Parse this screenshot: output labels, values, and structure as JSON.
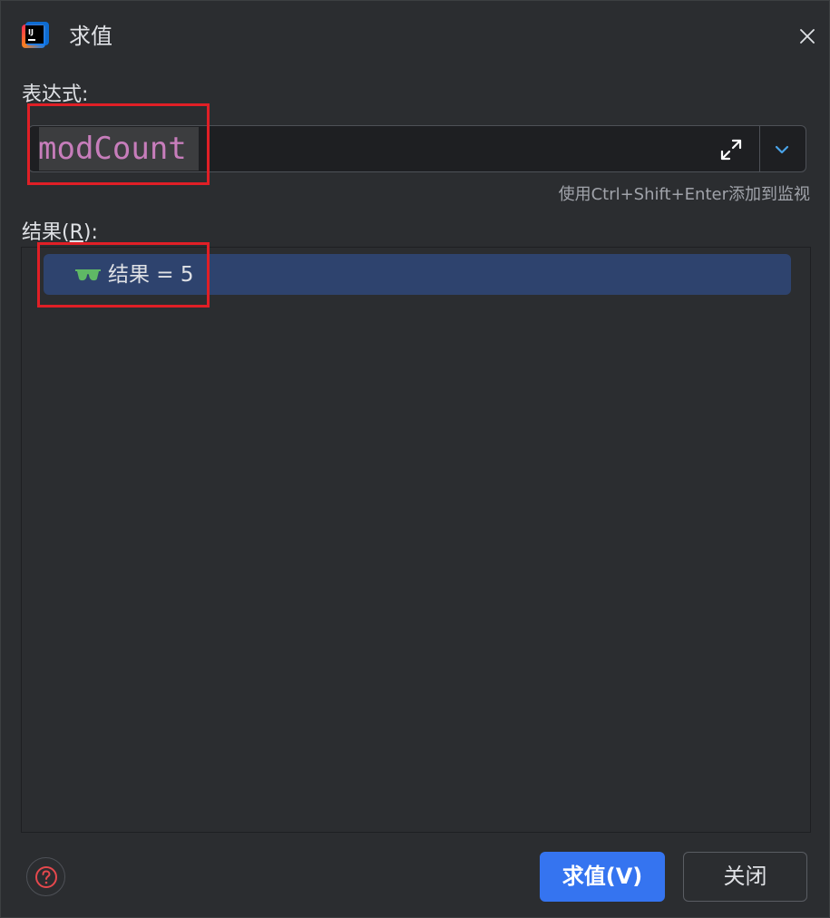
{
  "dialog": {
    "title": "求值",
    "app_icon": "intellij-idea-icon",
    "close_icon": "close-icon"
  },
  "expression": {
    "label": "表达式:",
    "value": "modCount",
    "expand_icon": "expand-icon",
    "history_icon": "chevron-down-icon",
    "hint": "使用Ctrl+Shift+Enter添加到监视"
  },
  "result": {
    "label_prefix": "结果(",
    "label_mnemonic": "R",
    "label_suffix": "):",
    "rows": [
      {
        "icon": "watch-glasses-icon",
        "text": "结果 = 5"
      }
    ]
  },
  "buttons": {
    "help_icon": "help-icon",
    "evaluate_label": "求值(V)",
    "close_label": "关闭"
  },
  "colors": {
    "background": "#2b2d30",
    "input_background": "#1e1f22",
    "expression_text": "#c77dbb",
    "selection_row": "#2e436e",
    "primary_button": "#3574f0",
    "annotation": "#e01f26",
    "watch_icon": "#5fb865",
    "help_icon": "#e5484d"
  }
}
